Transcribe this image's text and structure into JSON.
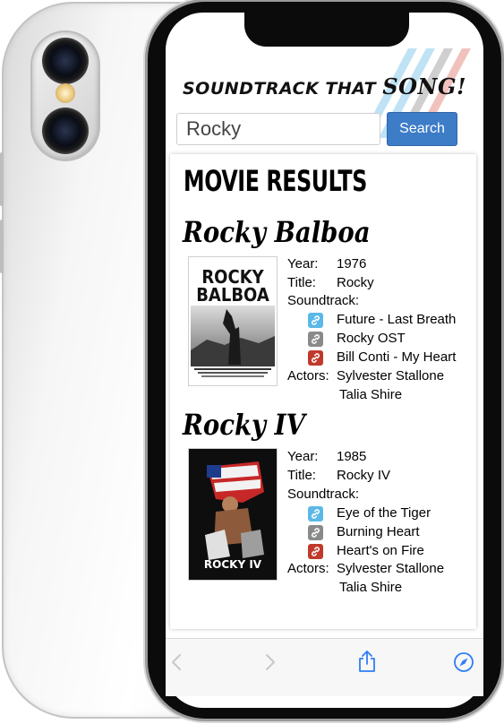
{
  "header": {
    "brand_text": "SOUNDTRACK THAT ",
    "brand_emphasis": "SONG!"
  },
  "search": {
    "value": "Rocky",
    "button_label": "Search"
  },
  "results": {
    "heading": "MOVIE RESULTS",
    "field_labels": {
      "year": "Year:",
      "title": "Title:",
      "soundtrack": "Soundtrack:",
      "actors": "Actors:"
    },
    "movies": [
      {
        "name": "Rocky Balboa",
        "poster_text_line1": "ROCKY",
        "poster_text_line2": "BALBOA",
        "year": "1976",
        "title": "Rocky",
        "soundtrack": [
          {
            "label": "Future - Last Breath",
            "icon": "link-icon",
            "color": "#5bb8e8"
          },
          {
            "label": "Rocky OST",
            "icon": "link-icon",
            "color": "#8a8a8a"
          },
          {
            "label": "Bill Conti - My Heart",
            "icon": "link-icon",
            "color": "#c0392b"
          }
        ],
        "actors": [
          "Sylvester Stallone",
          "Talia Shire"
        ]
      },
      {
        "name": "Rocky IV",
        "poster_text_line1": "ROCKY IV",
        "year": "1985",
        "title": "Rocky IV",
        "soundtrack": [
          {
            "label": "Eye of the Tiger",
            "icon": "link-icon",
            "color": "#5bb8e8"
          },
          {
            "label": "Burning Heart",
            "icon": "link-icon",
            "color": "#8a8a8a"
          },
          {
            "label": "Heart's on Fire",
            "icon": "link-icon",
            "color": "#c0392b"
          }
        ],
        "actors": [
          "Sylvester Stallone",
          "Talia Shire"
        ]
      }
    ]
  },
  "toolbar": {
    "icons": [
      "back-icon",
      "forward-icon",
      "share-icon",
      "compass-icon"
    ]
  },
  "colors": {
    "accent": "#3d7cc7",
    "stripe_blue": "#bfe3f5",
    "stripe_gray": "#c9c9c9",
    "stripe_red": "#f1c2bd"
  }
}
